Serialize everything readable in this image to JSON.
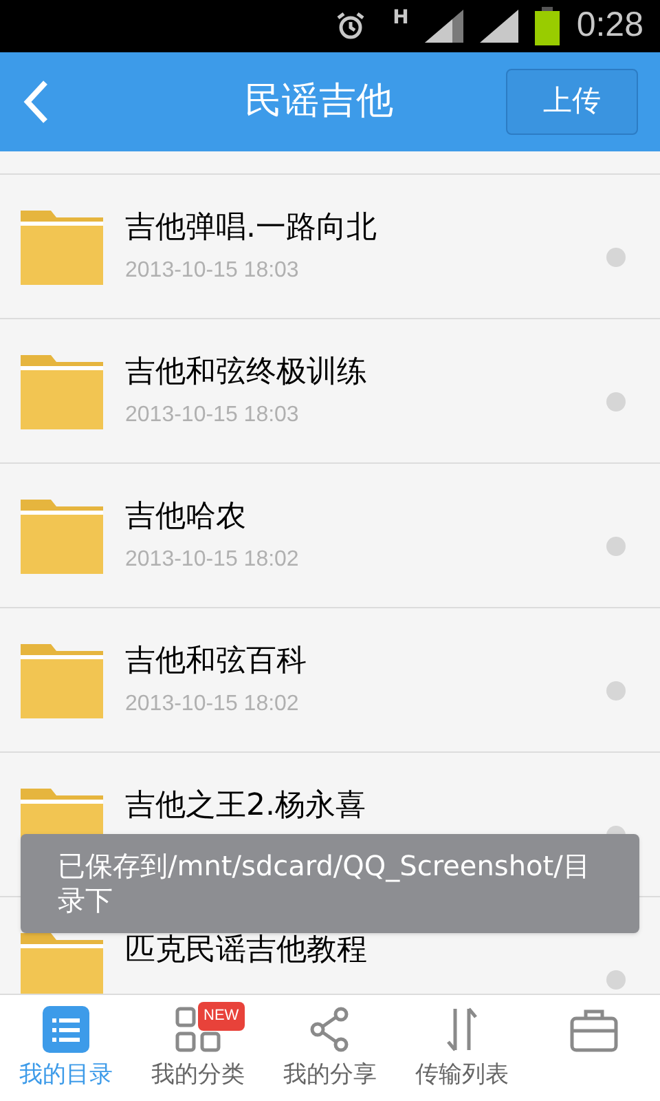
{
  "status_bar": {
    "network": "H",
    "time": "0:28"
  },
  "header": {
    "title": "民谣吉他",
    "action": "上传"
  },
  "folders": [
    {
      "name": "吉他弹唱.一路向北",
      "date": "2013-10-15  18:03"
    },
    {
      "name": "吉他和弦终极训练",
      "date": "2013-10-15  18:03"
    },
    {
      "name": "吉他哈农",
      "date": "2013-10-15  18:02"
    },
    {
      "name": "吉他和弦百科",
      "date": "2013-10-15  18:02"
    },
    {
      "name": "吉他之王2.杨永喜"
    },
    {
      "name": "匹克民谣吉他教程"
    }
  ],
  "toast": "已保存到/mnt/sdcard/QQ_Screenshot/目录下",
  "bottom_nav": [
    {
      "kind": "list",
      "label": "我的目录",
      "selected": true
    },
    {
      "kind": "grid",
      "label": "我的分类",
      "selected": false,
      "badge": "NEW"
    },
    {
      "kind": "share",
      "label": "我的分享",
      "selected": false
    },
    {
      "kind": "transfer",
      "label": "传输列表",
      "selected": false
    },
    {
      "kind": "toolbox",
      "selected": false
    }
  ]
}
